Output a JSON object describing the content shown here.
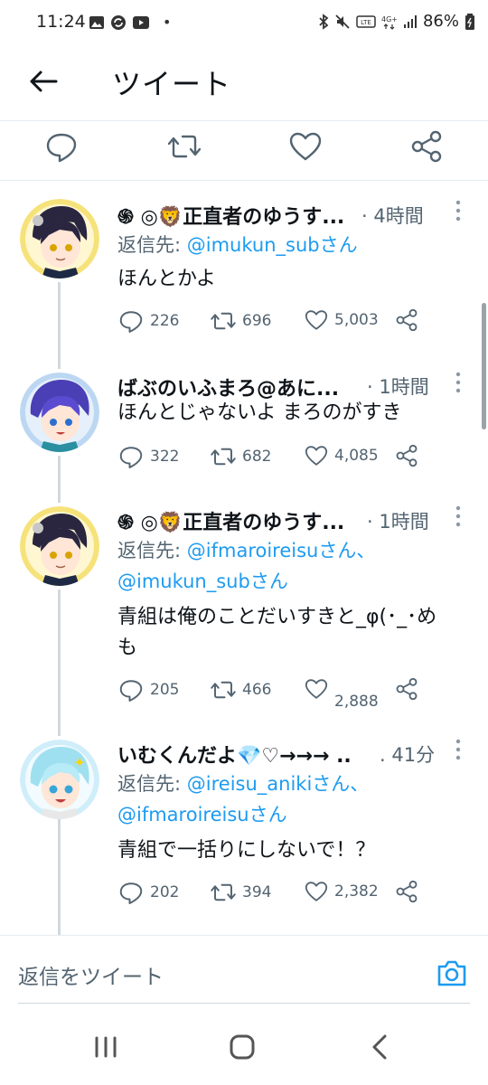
{
  "status_bar": {
    "time": "11:24",
    "dot": "•",
    "battery": "86%",
    "icons_left": [
      "gallery-icon",
      "sync-icon",
      "youtube-icon"
    ],
    "icons_right": [
      "bluetooth-icon",
      "mute-icon",
      "volte-icon",
      "4g-icon",
      "signal-icon",
      "battery-icon"
    ]
  },
  "header": {
    "title": "ツイート"
  },
  "action_bar": {
    "icons": [
      "reply-icon",
      "retweet-icon",
      "like-icon",
      "share-icon"
    ]
  },
  "tweets": [
    {
      "name": "֍ ◎🦁正直者のゆうす...",
      "time": "· 4時間",
      "reply_prefix": "返信先: ",
      "reply_links": "@imukun_subさん",
      "reply_links_2": "",
      "text": "ほんとかよ",
      "replies": "226",
      "retweets": "696",
      "likes": "5,003"
    },
    {
      "name": "ばぶのいふまろ@あに...",
      "time": "· 1時間",
      "text": "ほんとじゃないよ まろのがすき",
      "replies": "322",
      "retweets": "682",
      "likes": "4,085"
    },
    {
      "name": "֍ ◎🦁正直者のゆうす...",
      "time": "· 1時間",
      "reply_prefix": "返信先: ",
      "reply_links": "@ifmaroireisuさん、",
      "reply_links_2": "@imukun_subさん",
      "text": "青組は俺のことだいすきと_φ(･_･め",
      "text_2": "も",
      "replies": "205",
      "retweets": "466",
      "likes": "2,888"
    },
    {
      "name": "いむくんだよ💎♡→→→ ..",
      "time": ". 41分",
      "reply_prefix": "返信先: ",
      "reply_links": "@ireisu_anikiさん、",
      "reply_links_2": "@ifmaroireisuさん",
      "text": "青組で一括りにしないで！？",
      "replies": "202",
      "retweets": "394",
      "likes": "2,382"
    }
  ],
  "composer": {
    "placeholder": "返信をツイート"
  },
  "colors": {
    "accent": "#1d9bf0",
    "muted": "#536471",
    "text": "#0f1419",
    "divider": "#e6ecf0"
  }
}
